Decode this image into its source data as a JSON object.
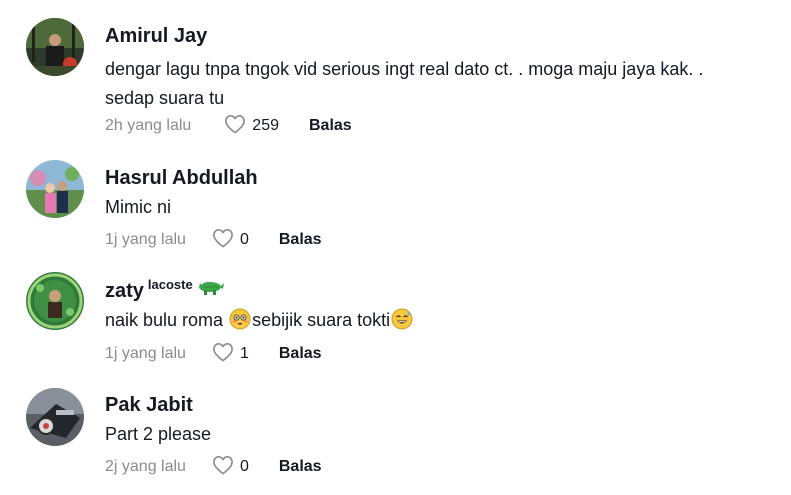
{
  "comments": [
    {
      "username": "Amirul Jay",
      "text_lines": [
        "dengar lagu tnpa tngok vid serious ingt real dato ct. . moga maju jaya kak. .",
        "sedap suara tu"
      ],
      "time": "2h yang lalu",
      "likes": "259",
      "reply_label": "Balas",
      "avatar_icon": "avatar-photo"
    },
    {
      "username": "Hasrul Abdullah",
      "text_lines": [
        "Mimic ni"
      ],
      "time": "1j yang lalu",
      "likes": "0",
      "reply_label": "Balas",
      "avatar_icon": "avatar-photo"
    },
    {
      "username": "zaty",
      "username_suffix": "lacoste",
      "username_emoji": "crocodile-icon",
      "text_parts": [
        "naik bulu roma ",
        "sebijik suara tokti"
      ],
      "text_emojis": [
        "flushed-face-emoji",
        "sweat-smile-emoji"
      ],
      "time": "1j yang lalu",
      "likes": "1",
      "reply_label": "Balas",
      "avatar_icon": "avatar-photo"
    },
    {
      "username": "Pak Jabit",
      "text_lines": [
        "Part 2 please"
      ],
      "time": "2j yang lalu",
      "likes": "0",
      "reply_label": "Balas",
      "avatar_icon": "avatar-photo"
    }
  ],
  "colors": {
    "text_primary": "#161823",
    "text_secondary": "#8a8b91",
    "heart_outline": "#8a8b91"
  },
  "icons": {
    "like": "heart-outline-icon"
  }
}
